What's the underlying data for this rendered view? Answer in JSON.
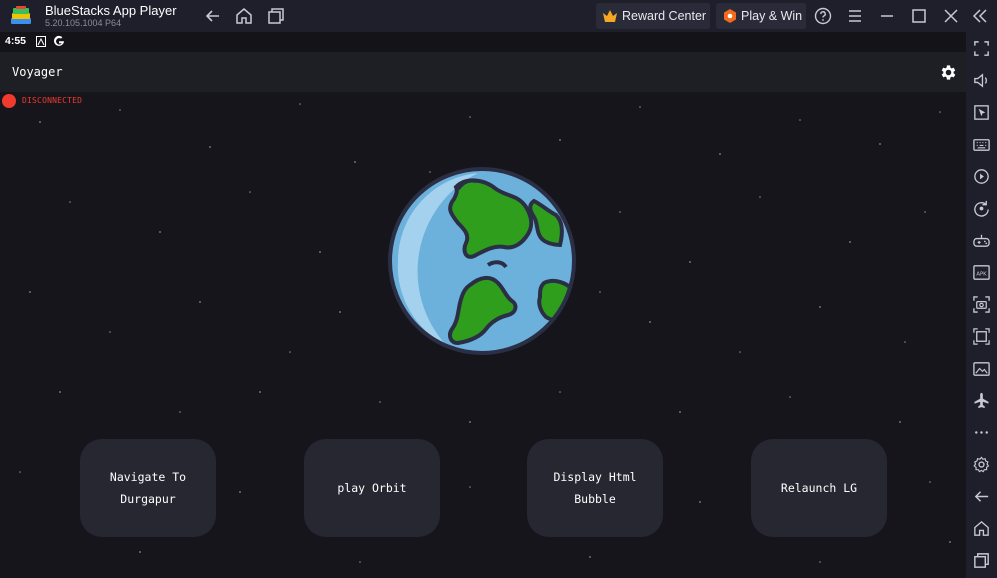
{
  "window": {
    "title": "BlueStacks App Player",
    "version": "5.20.105.1004  P64",
    "reward_center_label": "Reward Center",
    "play_win_label": "Play & Win"
  },
  "statusbar": {
    "time": "4:55"
  },
  "app": {
    "title": "Voyager",
    "connection_status": "DISCONNECTED",
    "status_color": "#f03a2e"
  },
  "actions": [
    {
      "label": "Navigate To\nDurgapur"
    },
    {
      "label": "play Orbit"
    },
    {
      "label": "Display Html\nBubble"
    },
    {
      "label": "Relaunch LG"
    }
  ],
  "sidebar_icons": [
    "fullscreen-icon",
    "volume-icon",
    "pointer-icon",
    "keyboard-icon",
    "macro-play-icon",
    "rotate-icon",
    "gamepad-icon",
    "apk-icon",
    "screenshot-icon",
    "resize-icon",
    "media-folder-icon",
    "airplane-icon",
    "more-icon",
    "settings-icon",
    "back-icon",
    "home-icon",
    "recents-icon"
  ]
}
